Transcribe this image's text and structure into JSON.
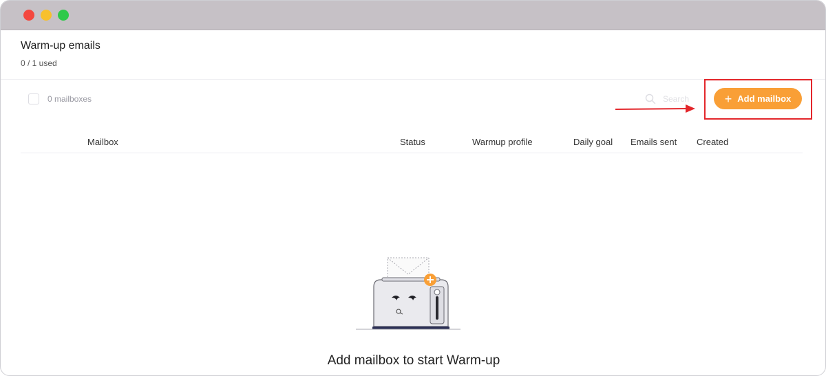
{
  "page": {
    "title": "Warm-up emails",
    "usage": "0 / 1 used"
  },
  "toolbar": {
    "mailbox_count": "0 mailboxes",
    "search_placeholder": "Search",
    "add_button_label": "Add mailbox"
  },
  "table": {
    "columns": [
      "Mailbox",
      "Status",
      "Warmup profile",
      "Daily goal",
      "Emails sent",
      "Created"
    ]
  },
  "empty_state": {
    "message": "Add mailbox to start Warm-up",
    "illustration": "toaster-with-envelope-icon"
  },
  "colors": {
    "accent": "#f99f36",
    "annotation": "#e3262b",
    "titlebar": "#c6c1c6"
  }
}
